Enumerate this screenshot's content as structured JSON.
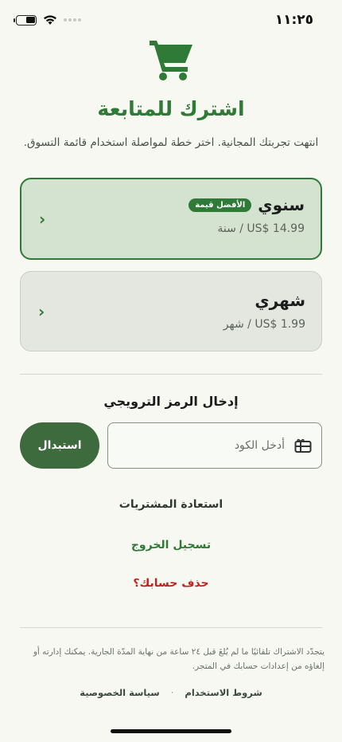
{
  "status_bar": {
    "time": "١١:٢٥"
  },
  "header": {
    "icon": "shopping-cart-icon",
    "title": "اشترك للمتابعة",
    "subtitle": "انتهت تجربتك المجانية. اختر خطة لمواصلة استخدام قائمة التسوق."
  },
  "plans": [
    {
      "name": "سنوي",
      "badge": "الأفضل قيمة",
      "price": "US$ 14.99 / سنة",
      "selected": true
    },
    {
      "name": "شهري",
      "price": "US$ 1.99 / شهر",
      "selected": false
    }
  ],
  "promo": {
    "title": "إدخال الرمز الترويجي",
    "placeholder": "أدخل الكود",
    "icon": "gift-card-icon",
    "redeem_label": "استبدال"
  },
  "links": {
    "restore": "استعادة المشتريات",
    "logout": "تسجيل الخروج",
    "delete": "حذف حسابك؟"
  },
  "footer": {
    "note": "يتجدّد الاشتراك تلقائيًا ما لم يُلغَ قبل ٢٤ ساعة من نهاية المدّة الجارية. يمكنك إدارته أو إلغاؤه من إعدادات حسابك في المتجر.",
    "terms": "شروط الاستخدام",
    "separator": "·",
    "privacy": "سياسة الخصوصية"
  },
  "colors": {
    "accent": "#2f7a37",
    "button": "#3d6b3d",
    "danger": "#c0241f",
    "background": "#f6f8f1"
  }
}
